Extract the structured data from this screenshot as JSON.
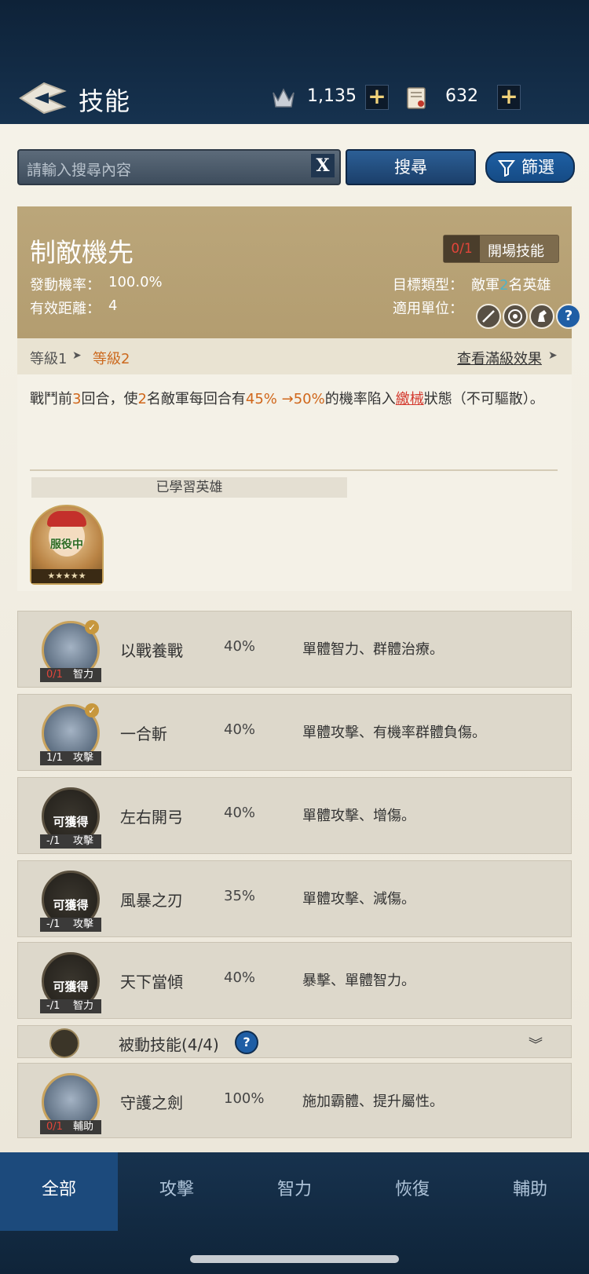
{
  "header": {
    "title": "技能",
    "resources": [
      {
        "name": "crown-icon",
        "value": "1,135"
      },
      {
        "name": "scroll-icon",
        "value": "632"
      }
    ],
    "plus": "+"
  },
  "search": {
    "placeholder": "請輸入搜尋內容",
    "clear": "X",
    "button": "搜尋",
    "filter": "篩選"
  },
  "detail": {
    "name": "制敵機先",
    "tag_count": "0/1",
    "tag_label": "開場技能",
    "trigger_label": "發動機率：",
    "trigger_value": "100.0%",
    "range_label": "有效距離：",
    "range_value": "4",
    "target_label": "目標類型：",
    "target_pre": "敵軍",
    "target_num": "2",
    "target_post": "名英雄",
    "units_label": "適用單位：",
    "unit_icons": [
      "sword-icon",
      "target-icon",
      "horse-icon",
      "help-icon"
    ],
    "help": "?",
    "level1": "等級1",
    "level2": "等級2",
    "full_level": "查看滿級效果",
    "desc": {
      "p1": "戰鬥前",
      "n1": "3",
      "p2": "回合，使",
      "n2": "2",
      "p3": "名敵軍每回合有",
      "n3": "45% →50%",
      "p4": "的機率陷入",
      "state": "繳械",
      "p5": "狀態（不可驅散）。"
    },
    "learned_header": "已學習英雄",
    "hero_status": "服役中",
    "hero_stars": "★★★★★"
  },
  "skills": [
    {
      "name": "以戰養戰",
      "rate": "40%",
      "desc": "單體智力、群體治療。",
      "count": "0/1",
      "type": "智力",
      "available": ""
    },
    {
      "name": "一合斬",
      "rate": "40%",
      "desc": "單體攻擊、有機率群體負傷。",
      "count": "1/1",
      "type": "攻擊",
      "available": ""
    },
    {
      "name": "左右開弓",
      "rate": "40%",
      "desc": "單體攻擊、增傷。",
      "count": "-/1",
      "type": "攻擊",
      "available": "可獲得"
    },
    {
      "name": "風暴之刃",
      "rate": "35%",
      "desc": "單體攻擊、減傷。",
      "count": "-/1",
      "type": "攻擊",
      "available": "可獲得"
    },
    {
      "name": "天下當傾",
      "rate": "40%",
      "desc": "暴擊、單體智力。",
      "count": "-/1",
      "type": "智力",
      "available": "可獲得"
    }
  ],
  "passive": {
    "label": "被動技能(4/4)",
    "help": "?"
  },
  "passive_skill": {
    "name": "守護之劍",
    "rate": "100%",
    "desc": "施加霸體、提升屬性。",
    "count": "0/1",
    "type": "輔助"
  },
  "tabs": [
    "全部",
    "攻擊",
    "智力",
    "恢復",
    "輔助"
  ],
  "colors": {
    "accent_orange": "#d0661a",
    "header_navy": "#16324f",
    "banner_tan": "#b39d70"
  }
}
